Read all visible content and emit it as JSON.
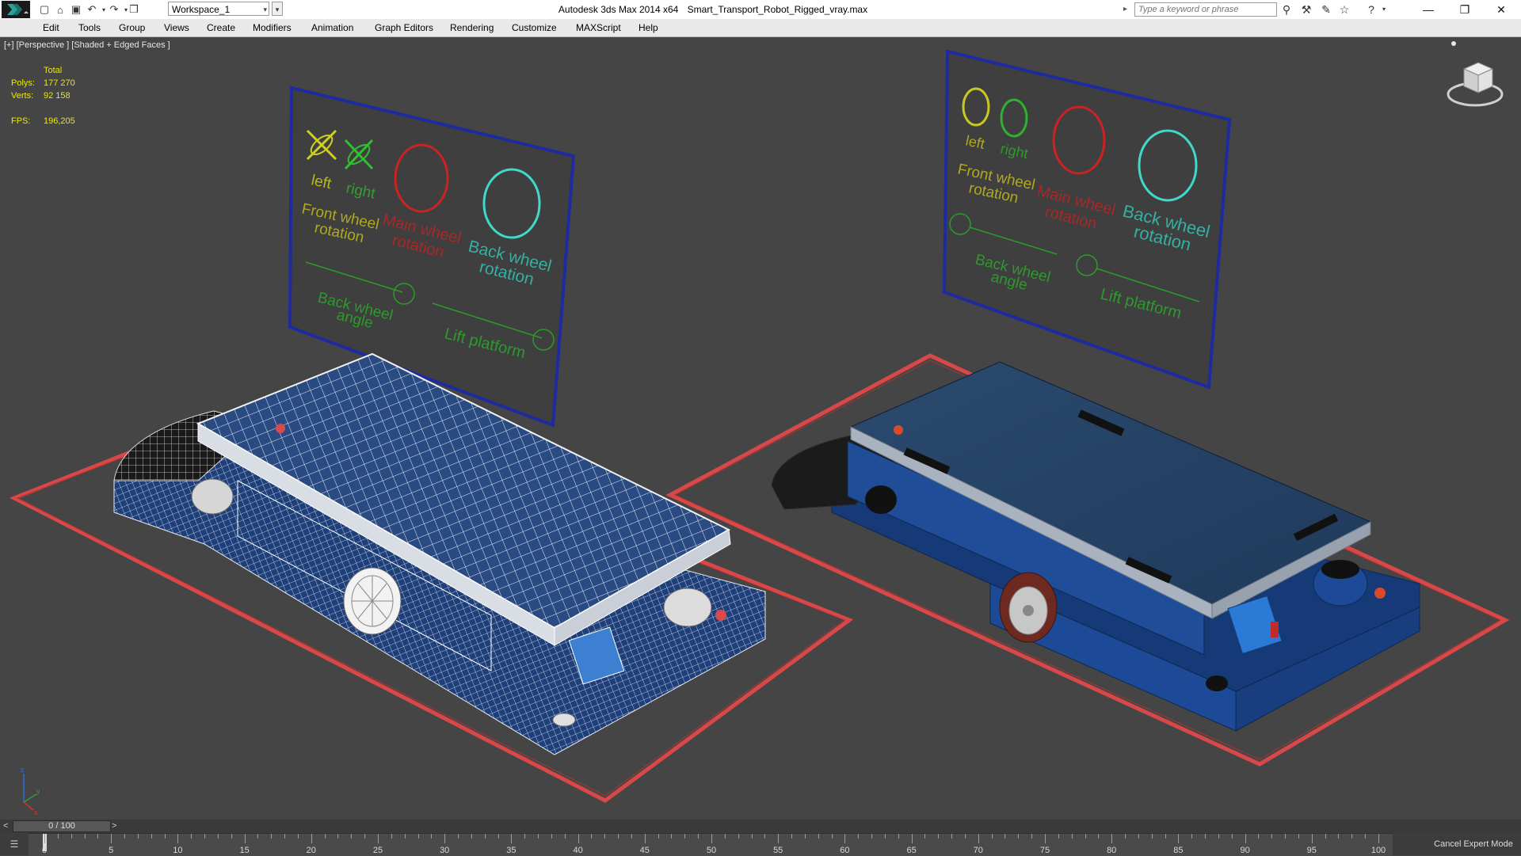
{
  "title_bar": {
    "app_name": "Autodesk 3ds Max  2014 x64",
    "file_name": "Smart_Transport_Robot_Rigged_vray.max",
    "workspace": "Workspace_1",
    "search_placeholder": "Type a keyword or phrase"
  },
  "menu": [
    "Edit",
    "Tools",
    "Group",
    "Views",
    "Create",
    "Modifiers",
    "Animation",
    "Graph Editors",
    "Rendering",
    "Customize",
    "MAXScript",
    "Help"
  ],
  "viewport": {
    "label": "[+] [Perspective ] [Shaded + Edged Faces ]",
    "stats": {
      "header": "Total",
      "polys_label": "Polys:",
      "polys": "177 270",
      "verts_label": "Verts:",
      "verts": "92 158",
      "fps_label": "FPS:",
      "fps": "196,205"
    },
    "rig_panel": {
      "left_label": "left",
      "right_label": "right",
      "front_wheel": "Front wheel",
      "rotation": "rotation",
      "main_wheel": "Main wheel",
      "back_wheel": "Back wheel",
      "angle": "angle",
      "lift_platform": "Lift platform"
    },
    "axis": {
      "x": "x",
      "y": "y",
      "z": "z"
    }
  },
  "timeline": {
    "frame_display": "0 / 100",
    "prev": "<",
    "next": ">",
    "current_frame": 0,
    "total_frames": 100,
    "tick_labels": [
      "0",
      "5",
      "10",
      "15",
      "20",
      "25",
      "30",
      "35",
      "40",
      "45",
      "50",
      "55",
      "60",
      "65",
      "70",
      "75",
      "80",
      "85",
      "90",
      "95",
      "100"
    ],
    "cancel_expert_mode": "Cancel Expert Mode"
  }
}
